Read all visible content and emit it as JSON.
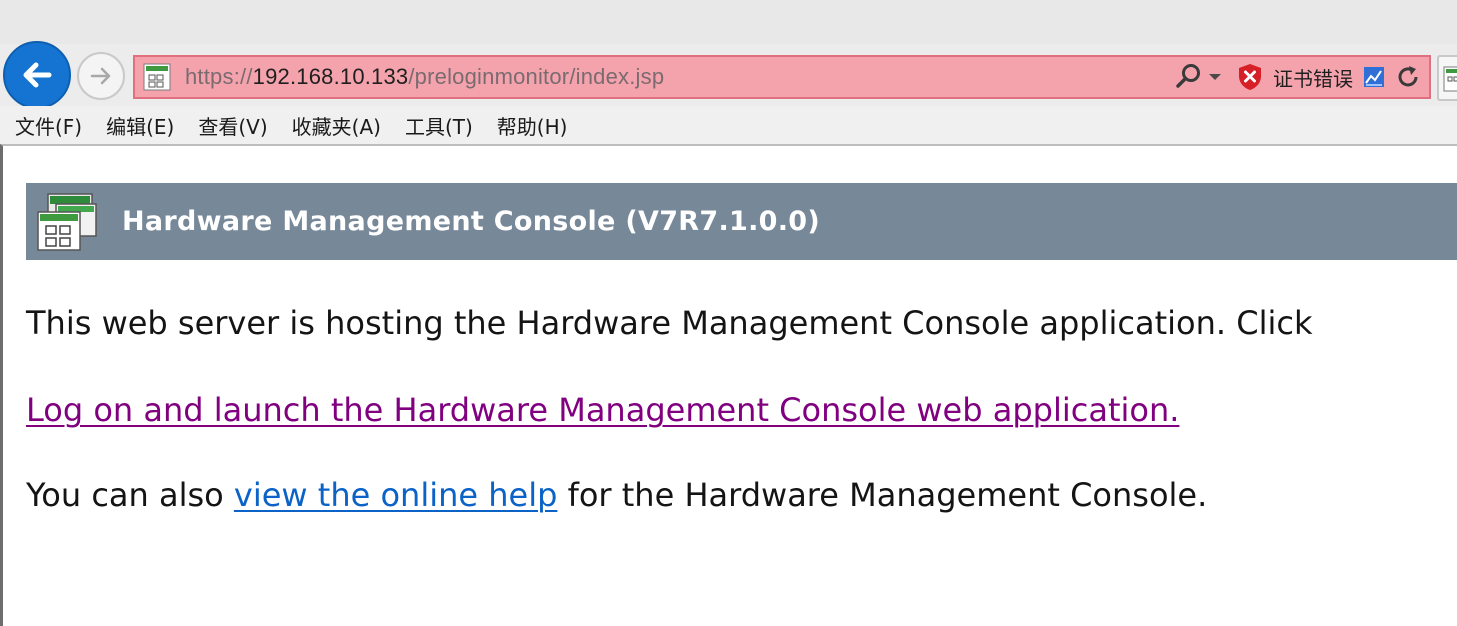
{
  "browser": {
    "address": {
      "scheme": "https://",
      "host": "192.168.10.133",
      "path": "/preloginmonitor/index.jsp"
    },
    "cert_error_label": "证书错误",
    "menu": [
      {
        "label": "文件(F)"
      },
      {
        "label": "编辑(E)"
      },
      {
        "label": "查看(V)"
      },
      {
        "label": "收藏夹(A)"
      },
      {
        "label": "工具(T)"
      },
      {
        "label": "帮助(H)"
      }
    ],
    "address_bar_color": "#f4a3ad",
    "back_button_color": "#1573d1"
  },
  "page": {
    "banner_title": "Hardware Management Console (V7R7.1.0.0)",
    "banner_color": "#778899",
    "intro_text": "This web server is hosting the Hardware Management Console application.  Click",
    "launch_link": "Log on and launch the Hardware Management Console web application.",
    "help_prefix": "You can also ",
    "help_link": "view the online help",
    "help_suffix": " for the Hardware Management Console.",
    "link_visited_color": "#800080",
    "link_color": "#0b62c7"
  }
}
